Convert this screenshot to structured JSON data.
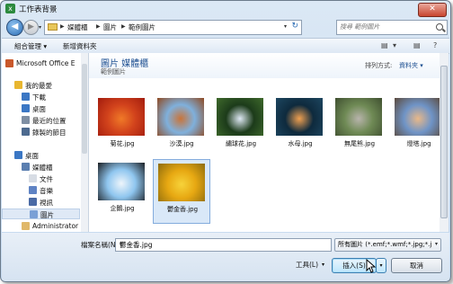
{
  "window": {
    "title": "工作表背景",
    "close_glyph": "✕"
  },
  "address": {
    "crumbs": [
      "媒體櫃",
      "圖片",
      "範例圖片"
    ],
    "search_placeholder": "搜尋 範例圖片"
  },
  "toolbar": {
    "organize": "組合管理 ▾",
    "new_folder": "新增資料夾"
  },
  "sidebar": {
    "items": [
      {
        "label": "Microsoft Office E",
        "icon": "office-icon"
      },
      {
        "label": "我的最愛",
        "icon": "star-icon"
      },
      {
        "label": "下載",
        "icon": "download-icon"
      },
      {
        "label": "桌面",
        "icon": "desktop-icon"
      },
      {
        "label": "最近的位置",
        "icon": "recent-icon"
      },
      {
        "label": "錄製的節目",
        "icon": "tv-icon"
      },
      {
        "label": "桌面",
        "icon": "desktop-icon"
      },
      {
        "label": "媒體櫃",
        "icon": "library-icon"
      },
      {
        "label": "文件",
        "icon": "document-icon"
      },
      {
        "label": "音樂",
        "icon": "music-icon"
      },
      {
        "label": "視訊",
        "icon": "video-icon"
      },
      {
        "label": "圖片",
        "icon": "pictures-icon"
      },
      {
        "label": "Administrator",
        "icon": "user-icon"
      }
    ]
  },
  "library": {
    "title": "圖片 媒體櫃",
    "subtitle": "範例圖片",
    "arrange_label": "排列方式:",
    "arrange_value": "資料夾 ▾"
  },
  "files": [
    {
      "name": "菊花.jpg",
      "colors": [
        "#d2431c",
        "#f07a28",
        "#a31c0e"
      ]
    },
    {
      "name": "沙漠.jpg",
      "colors": [
        "#7fb0dc",
        "#c9743a",
        "#8f4a22"
      ]
    },
    {
      "name": "繡球花.jpg",
      "colors": [
        "#1c3b1a",
        "#dfe9f5",
        "#3f6a2c"
      ]
    },
    {
      "name": "水母.jpg",
      "colors": [
        "#0e2a3d",
        "#f0a050",
        "#1d4660"
      ]
    },
    {
      "name": "無尾熊.jpg",
      "colors": [
        "#6f8a55",
        "#b8b4ac",
        "#3f4f30"
      ]
    },
    {
      "name": "燈塔.jpg",
      "colors": [
        "#6f94c7",
        "#e9b888",
        "#5c4a3c"
      ]
    },
    {
      "name": "企鵝.jpg",
      "colors": [
        "#8fc6ef",
        "#eef5fb",
        "#1b1f24"
      ]
    },
    {
      "name": "鬱金香.jpg",
      "colors": [
        "#e7a812",
        "#f7d33a",
        "#8d6b0d"
      ]
    }
  ],
  "selected_file": "鬱金香.jpg",
  "bottom": {
    "filename_label": "檔案名稱(N):",
    "filename_value": "鬱金香.jpg",
    "filter": "所有圖片 (*.emf;*.wmf;*.jpg;*.j",
    "tools": "工具(L)",
    "insert": "插入(S)",
    "cancel": "取消"
  },
  "icons": {
    "back": "◀",
    "forward": "▶",
    "dropdown": "▾",
    "refresh": "↻",
    "view": "▤",
    "help": "?"
  }
}
